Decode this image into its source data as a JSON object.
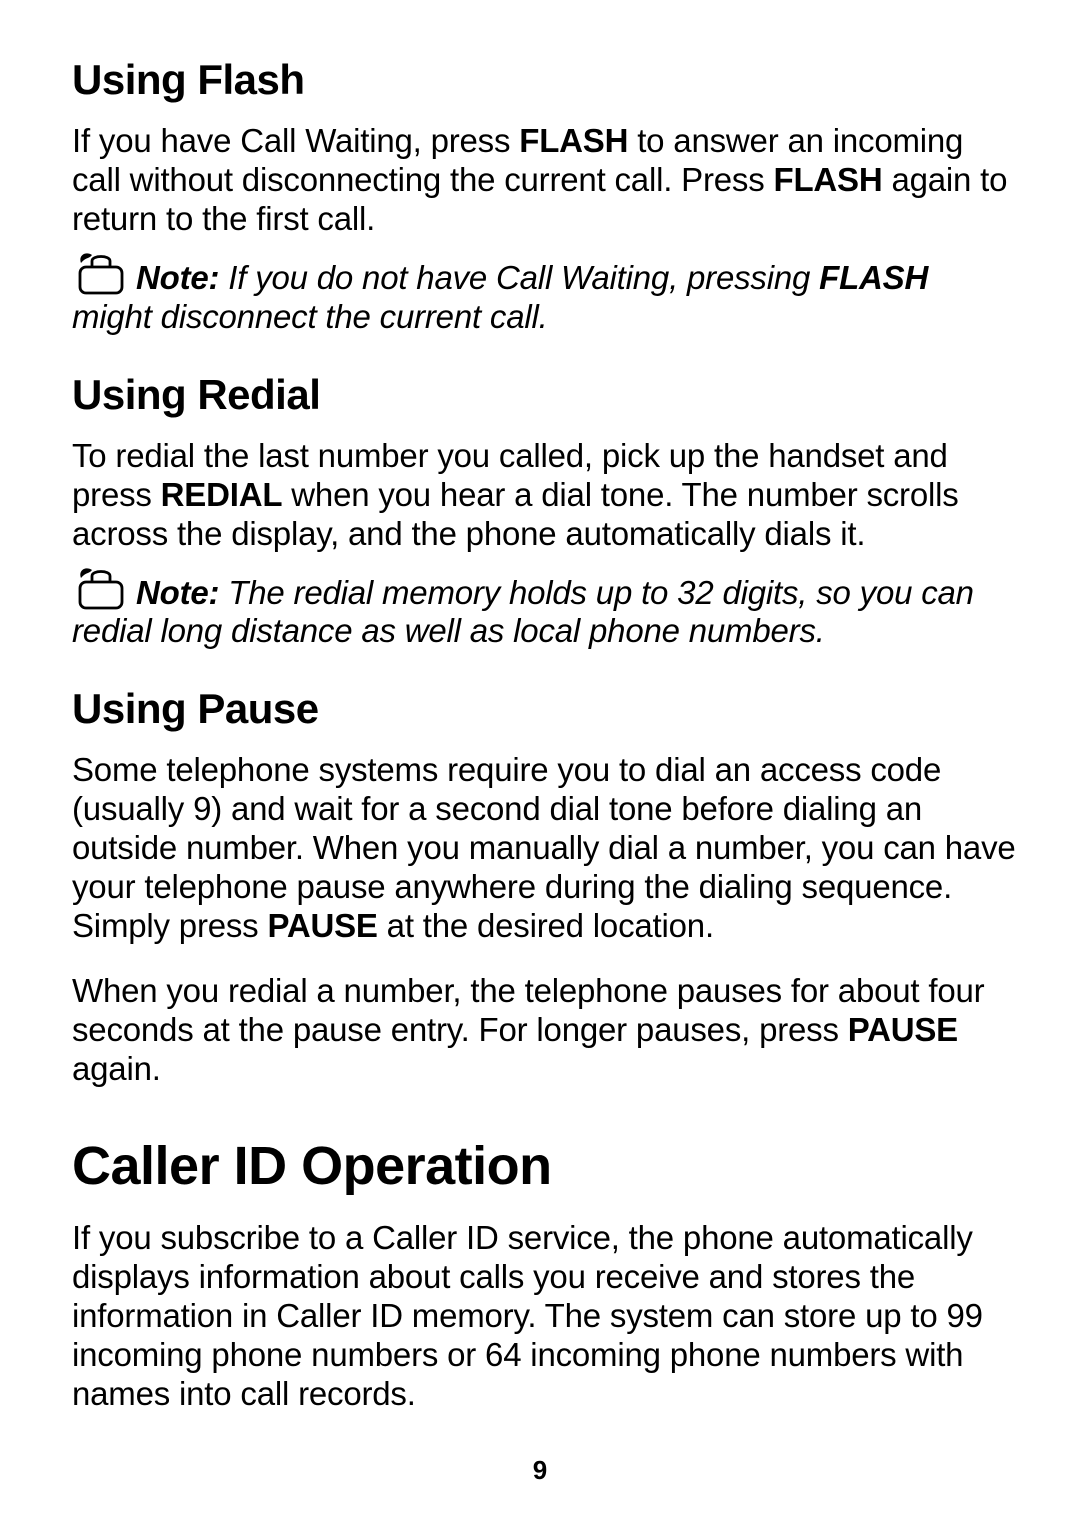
{
  "sections": {
    "flash": {
      "heading": "Using Flash",
      "para1_a": "If you have Call Waiting, press ",
      "para1_b": "FLASH",
      "para1_c": " to answer an incoming call without disconnecting the current call. Press ",
      "para1_d": "FLASH",
      "para1_e": " again to return to the first call.",
      "note_label": "Note:",
      "note_a": " If you do not have Call Waiting, pressing ",
      "note_b": "FLASH",
      "note_c": " might disconnect the current call."
    },
    "redial": {
      "heading": "Using Redial",
      "para1_a": "To redial the last number you called, pick up the handset and press ",
      "para1_b": "REDIAL",
      "para1_c": " when you hear a dial tone. The number scrolls across the display, and the phone automatically dials it.",
      "note_label": "Note:",
      "note_a": " The redial memory holds up to 32 digits, so you can redial long distance as well as local phone numbers."
    },
    "pause": {
      "heading": "Using Pause",
      "para1_a": "Some telephone systems require you to dial an access code (usually 9) and wait for a second dial tone before dialing an outside number. When you manually dial a number, you can have your telephone pause anywhere during the dialing sequence. Simply press ",
      "para1_b": "PAUSE",
      "para1_c": " at the desired location.",
      "para2_a": "When you redial a number, the telephone pauses for about four seconds at the pause entry. For longer pauses, press ",
      "para2_b": "PAUSE",
      "para2_c": " again."
    },
    "callerid": {
      "heading": "Caller ID Operation",
      "para1": "If you subscribe to a Caller ID service, the phone automatically displays information about calls you receive and stores the information in Caller ID memory. The system can store up to 99 incoming phone numbers or 64 incoming phone numbers with names into call records."
    }
  },
  "page_number": "9"
}
